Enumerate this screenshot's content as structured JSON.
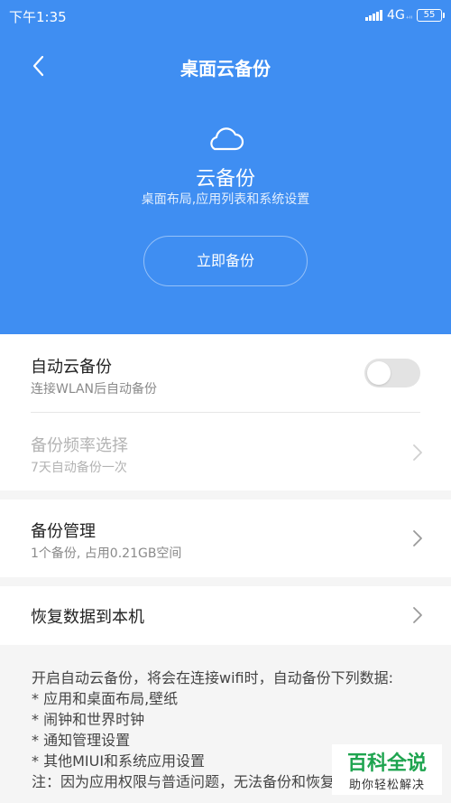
{
  "status_bar": {
    "time": "下午1:35",
    "network": "4G",
    "network_sub": "⁺ᴵᴵ",
    "battery": "55"
  },
  "header": {
    "title": "桌面云备份",
    "hero_title": "云备份",
    "hero_subtitle": "桌面布局,应用列表和系统设置",
    "backup_button": "立即备份",
    "icons": {
      "back": "chevron-left-icon",
      "cloud": "cloud-icon"
    }
  },
  "settings": {
    "auto_backup": {
      "title": "自动云备份",
      "subtitle": "连接WLAN后自动备份",
      "enabled": false
    },
    "frequency": {
      "title": "备份频率选择",
      "subtitle": "7天自动备份一次",
      "disabled": true
    },
    "manage": {
      "title": "备份管理",
      "subtitle": "1个备份, 占用0.21GB空间"
    },
    "restore": {
      "title": "恢复数据到本机"
    }
  },
  "note": {
    "intro": "开启自动云备份，将会在连接wifi时，自动备份下列数据:",
    "items": [
      "* 应用和桌面布局,壁纸",
      "* 闹钟和世界时钟",
      "* 通知管理设置",
      "* 其他MIUI和系统应用设置"
    ],
    "footer": "注：因为应用权限与普适问题，无法备份和恢复第三方"
  },
  "watermark": {
    "main": "百科全说",
    "sub": "助你轻松解决"
  },
  "colors": {
    "header_bg": "#3f8ef2",
    "toggle_off": "#e3e3e3",
    "watermark_green": "#1ea44f"
  }
}
